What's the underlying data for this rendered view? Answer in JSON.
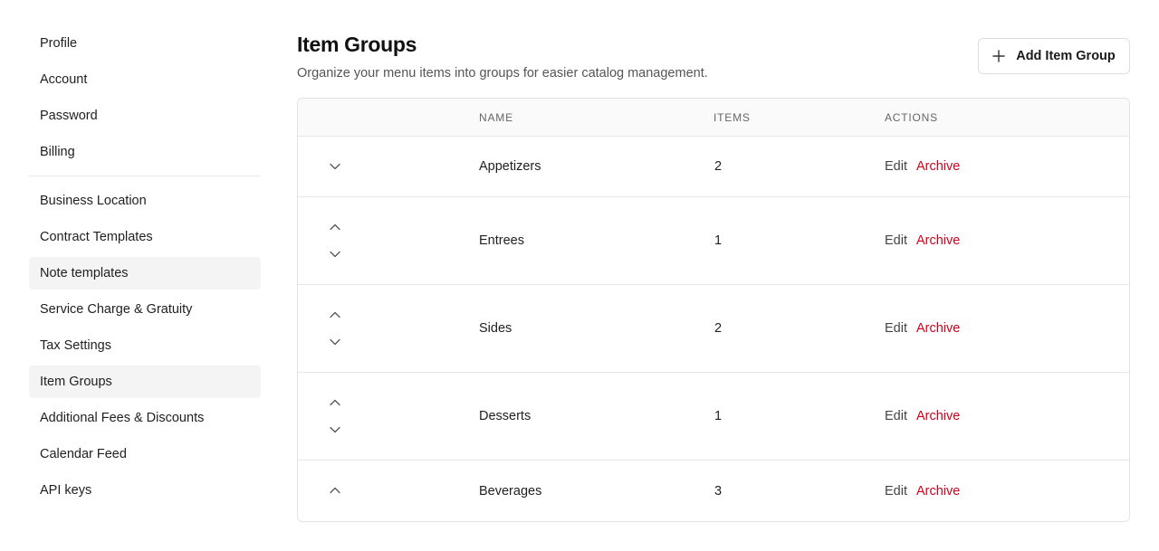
{
  "sidebar": {
    "group1": [
      "Profile",
      "Account",
      "Password",
      "Billing"
    ],
    "group2": [
      "Business Location",
      "Contract Templates",
      "Note templates",
      "Service Charge & Gratuity",
      "Tax Settings",
      "Item Groups",
      "Additional Fees & Discounts",
      "Calendar Feed",
      "API keys"
    ]
  },
  "header": {
    "title": "Item Groups",
    "subtitle": "Organize your menu items into groups for easier catalog management.",
    "add_button_label": "Add Item Group"
  },
  "table": {
    "columns": [
      "NAME",
      "ITEMS",
      "ACTIONS"
    ],
    "rows": [
      {
        "name": "Appetizers",
        "items": "2",
        "edit": "Edit",
        "archive": "Archive"
      },
      {
        "name": "Entrees",
        "items": "1",
        "edit": "Edit",
        "archive": "Archive"
      },
      {
        "name": "Sides",
        "items": "2",
        "edit": "Edit",
        "archive": "Archive"
      },
      {
        "name": "Desserts",
        "items": "1",
        "edit": "Edit",
        "archive": "Archive"
      },
      {
        "name": "Beverages",
        "items": "3",
        "edit": "Edit",
        "archive": "Archive"
      }
    ]
  },
  "colors": {
    "archive": "#d0021b",
    "active_nav_bg": "#f4f4f4"
  }
}
